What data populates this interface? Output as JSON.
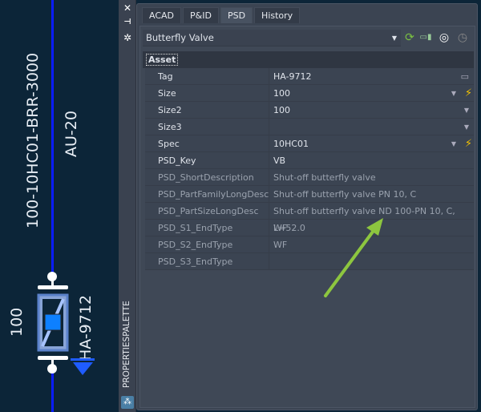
{
  "canvas": {
    "line_label": "100-10HC01-BRR-3000",
    "area_label": "AU-20",
    "size_label": "100",
    "tag_label": "HA-9712"
  },
  "side_strip": {
    "title": "PROPERTIESPALETTE",
    "icons": [
      "close-icon",
      "pin-icon",
      "settings-icon",
      "app-icon"
    ]
  },
  "tabs": [
    {
      "label": "ACAD"
    },
    {
      "label": "P&ID"
    },
    {
      "label": "PSD",
      "active": true
    },
    {
      "label": "History"
    }
  ],
  "class_dropdown": {
    "value": "Butterfly Valve"
  },
  "toolbar_icons": [
    "refresh-icon",
    "assign-tag-icon",
    "compare-icon",
    "history-icon"
  ],
  "section": {
    "title": "Asset"
  },
  "properties": [
    {
      "label": "Tag",
      "value": "HA-9712",
      "control": "button"
    },
    {
      "label": "Size",
      "value": "100",
      "control": "dropdown-bolt"
    },
    {
      "label": "Size2",
      "value": "100",
      "control": "dropdown"
    },
    {
      "label": "Size3",
      "value": "",
      "control": "dropdown"
    },
    {
      "label": "Spec",
      "value": "10HC01",
      "control": "dropdown-bolt"
    },
    {
      "label": "PSD_Key",
      "value": "VB"
    },
    {
      "label": "PSD_ShortDescription",
      "value": "Shut-off butterfly valve",
      "readonly": true
    },
    {
      "label": "PSD_PartFamilyLongDesc",
      "value": "Shut-off butterfly valve PN 10, C",
      "readonly": true
    },
    {
      "label": "PSD_PartSizeLongDesc",
      "value": "Shut-off butterfly valve ND 100-PN 10, C, L=52.0",
      "readonly": true
    },
    {
      "label": "PSD_S1_EndType",
      "value": "WF",
      "readonly": true
    },
    {
      "label": "PSD_S2_EndType",
      "value": "WF",
      "readonly": true
    },
    {
      "label": "PSD_S3_EndType",
      "value": "",
      "readonly": true
    }
  ],
  "colors": {
    "accent_arrow": "#8dc63f",
    "pipe": "#0a1dff",
    "bolt": "#f5c400"
  }
}
